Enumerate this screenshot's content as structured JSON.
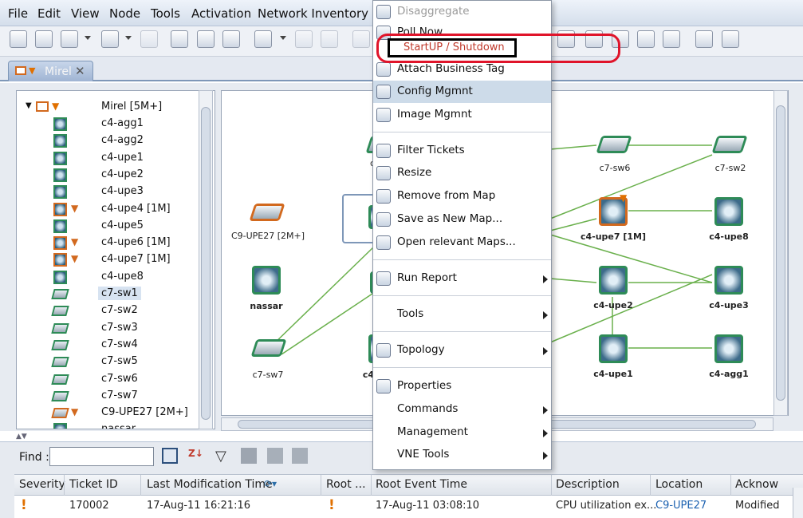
{
  "menubar": {
    "items": [
      "File",
      "Edit",
      "View",
      "Node",
      "Tools",
      "Activation",
      "Network Inventory"
    ]
  },
  "tab": {
    "label": "Mirel",
    "close": "✕"
  },
  "tree": {
    "root": "Mirel [5M+]",
    "items": [
      {
        "label": "c4-agg1",
        "kind": "router",
        "alarm": false
      },
      {
        "label": "c4-agg2",
        "kind": "router",
        "alarm": false
      },
      {
        "label": "c4-upe1",
        "kind": "router",
        "alarm": false
      },
      {
        "label": "c4-upe2",
        "kind": "router",
        "alarm": false
      },
      {
        "label": "c4-upe3",
        "kind": "router",
        "alarm": false
      },
      {
        "label": "c4-upe4 [1M]",
        "kind": "router",
        "alarm": true
      },
      {
        "label": "c4-upe5",
        "kind": "router",
        "alarm": false
      },
      {
        "label": "c4-upe6 [1M]",
        "kind": "router",
        "alarm": true
      },
      {
        "label": "c4-upe7 [1M]",
        "kind": "router",
        "alarm": true
      },
      {
        "label": "c4-upe8",
        "kind": "router",
        "alarm": false
      },
      {
        "label": "c7-sw1",
        "kind": "switch",
        "alarm": false,
        "selected": true
      },
      {
        "label": "c7-sw2",
        "kind": "switch",
        "alarm": false
      },
      {
        "label": "c7-sw3",
        "kind": "switch",
        "alarm": false
      },
      {
        "label": "c7-sw4",
        "kind": "switch",
        "alarm": false
      },
      {
        "label": "c7-sw5",
        "kind": "switch",
        "alarm": false
      },
      {
        "label": "c7-sw6",
        "kind": "switch",
        "alarm": false
      },
      {
        "label": "c7-sw7",
        "kind": "switch",
        "alarm": false
      },
      {
        "label": "C9-UPE27 [2M+]",
        "kind": "switch",
        "alarm": true
      },
      {
        "label": "nassar",
        "kind": "router",
        "alarm": false
      }
    ]
  },
  "map": {
    "nodes": {
      "c9upe27": "C9-UPE27 [2M+]",
      "nassar": "nassar",
      "c7sw7": "c7-sw7",
      "c7sw6": "c7-sw6",
      "c7sw2": "c7-sw2",
      "c4upe7": "c4-upe7 [1M]",
      "c4upe8": "c4-upe8",
      "c4upe2": "c4-upe2",
      "c4upe3": "c4-upe3",
      "c4upe1": "c4-upe1",
      "c4agg1": "c4-agg1",
      "partial_c": "c",
      "partial_c4": "c4"
    }
  },
  "context_menu": {
    "items": [
      {
        "label": "Disaggregate",
        "disabled": true,
        "icon": "disaggregate-icon"
      },
      {
        "label": "Poll Now",
        "icon": "poll-icon"
      },
      {
        "label": "",
        "icon": "startup-icon"
      },
      {
        "label": "Attach Business Tag",
        "icon": "tag-icon"
      },
      {
        "label": "Config Mgmnt",
        "icon": "config-icon",
        "highlighted": true
      },
      {
        "label": "Image Mgmnt",
        "icon": "image-icon"
      },
      {
        "label": "Filter Tickets",
        "icon": "filter-icon"
      },
      {
        "label": "Resize",
        "icon": "resize-icon"
      },
      {
        "label": "Remove from Map",
        "icon": "trash-icon"
      },
      {
        "label": "Save as New Map...",
        "icon": "save-map-icon"
      },
      {
        "label": "Open relevant Maps...",
        "icon": "open-maps-icon"
      },
      {
        "label": "Run Report",
        "icon": "report-icon",
        "submenu": true
      },
      {
        "label": "Tools",
        "icon": "",
        "submenu": true
      },
      {
        "label": "Topology",
        "icon": "topology-icon",
        "submenu": true
      },
      {
        "label": "Properties",
        "icon": "properties-icon"
      },
      {
        "label": "Commands",
        "icon": "",
        "submenu": true
      },
      {
        "label": "Management",
        "icon": "",
        "submenu": true
      },
      {
        "label": "VNE Tools",
        "icon": "",
        "submenu": true
      }
    ],
    "startup_label": "StartUP / Shutdown"
  },
  "find": {
    "label": "Find :",
    "value": ""
  },
  "tickets": {
    "columns": [
      "Severity",
      "Ticket ID",
      "Last Modification Time",
      "Root ...",
      "Root Event Time",
      "Description",
      "Location",
      "Acknow"
    ],
    "rows": [
      {
        "severity": "!",
        "ticket_id": "170002",
        "last_mod": "17-Aug-11 16:21:16",
        "root": "!",
        "root_event_time": "17-Aug-11 03:08:10",
        "description": "CPU utilization ex...",
        "location": "C9-UPE27",
        "ack": "Modified"
      }
    ]
  },
  "colors": {
    "alarm": "#d2691e",
    "ok": "#2e8b57",
    "link": "#1a60b0",
    "callout": "#e0142a",
    "startup_text": "#c0392b"
  }
}
